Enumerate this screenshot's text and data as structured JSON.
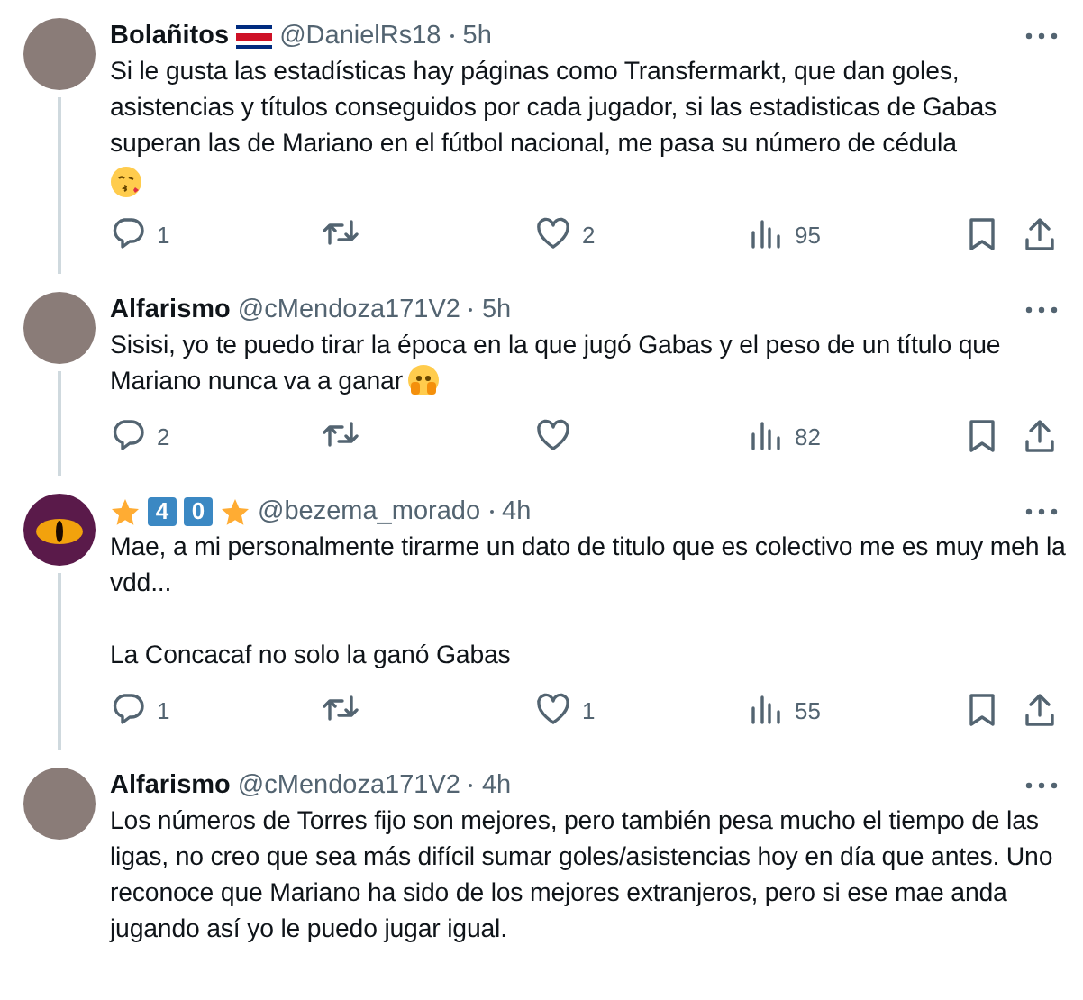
{
  "tweets": [
    {
      "name_parts": [
        {
          "kind": "text",
          "text": "Bolañitos"
        },
        {
          "kind": "flag"
        }
      ],
      "handle": "@DanielRs18",
      "time": "5h",
      "avatar": {
        "kind": "photo"
      },
      "connected": true,
      "paragraphs": [
        "Si le gusta las estadísticas hay páginas como Transfermarkt, que dan goles, asistencias y títulos conseguidos por cada jugador, si las estadisticas de Gabas superan las de Mariano en el fútbol nacional, me pasa su número de cédula"
      ],
      "emoji": {
        "kind": "kiss"
      },
      "emoji_own_line": true,
      "replies": "1",
      "likes": "2",
      "views": "95"
    },
    {
      "name_parts": [
        {
          "kind": "text",
          "text": "Alfarismo"
        }
      ],
      "handle": "@cMendoza171V2",
      "time": "5h",
      "avatar": {
        "kind": "photo"
      },
      "connected": true,
      "paragraphs": [
        "Sisisi, yo te puedo tirar la época en la que jugó  Gabas y el peso de un título que Mariano nunca va a ganar"
      ],
      "emoji": {
        "kind": "peek"
      },
      "emoji_own_line": false,
      "replies": "2",
      "views": "82"
    },
    {
      "name_parts": [
        {
          "kind": "star"
        },
        {
          "kind": "key",
          "text": "4"
        },
        {
          "kind": "key",
          "text": "0"
        },
        {
          "kind": "star"
        }
      ],
      "handle": "@bezema_morado",
      "time": "4h",
      "avatar": {
        "kind": "eye"
      },
      "connected": true,
      "paragraphs": [
        "Mae, a mi personalmente tirarme un dato de titulo que es colectivo me es muy meh la vdd...",
        "La Concacaf no solo la ganó Gabas"
      ],
      "replies": "1",
      "likes": "1",
      "views": "55"
    },
    {
      "name_parts": [
        {
          "kind": "text",
          "text": "Alfarismo"
        }
      ],
      "handle": "@cMendoza171V2",
      "time": "4h",
      "avatar": {
        "kind": "photo"
      },
      "connected": false,
      "paragraphs": [
        "Los números de Torres fijo son mejores, pero también pesa mucho el tiempo de las ligas, no creo que sea más difícil sumar goles/asistencias hoy en día que antes. Uno reconoce que Mariano ha sido de los mejores extranjeros, pero si ese mae anda jugando así yo le puedo jugar igual."
      ]
    }
  ]
}
